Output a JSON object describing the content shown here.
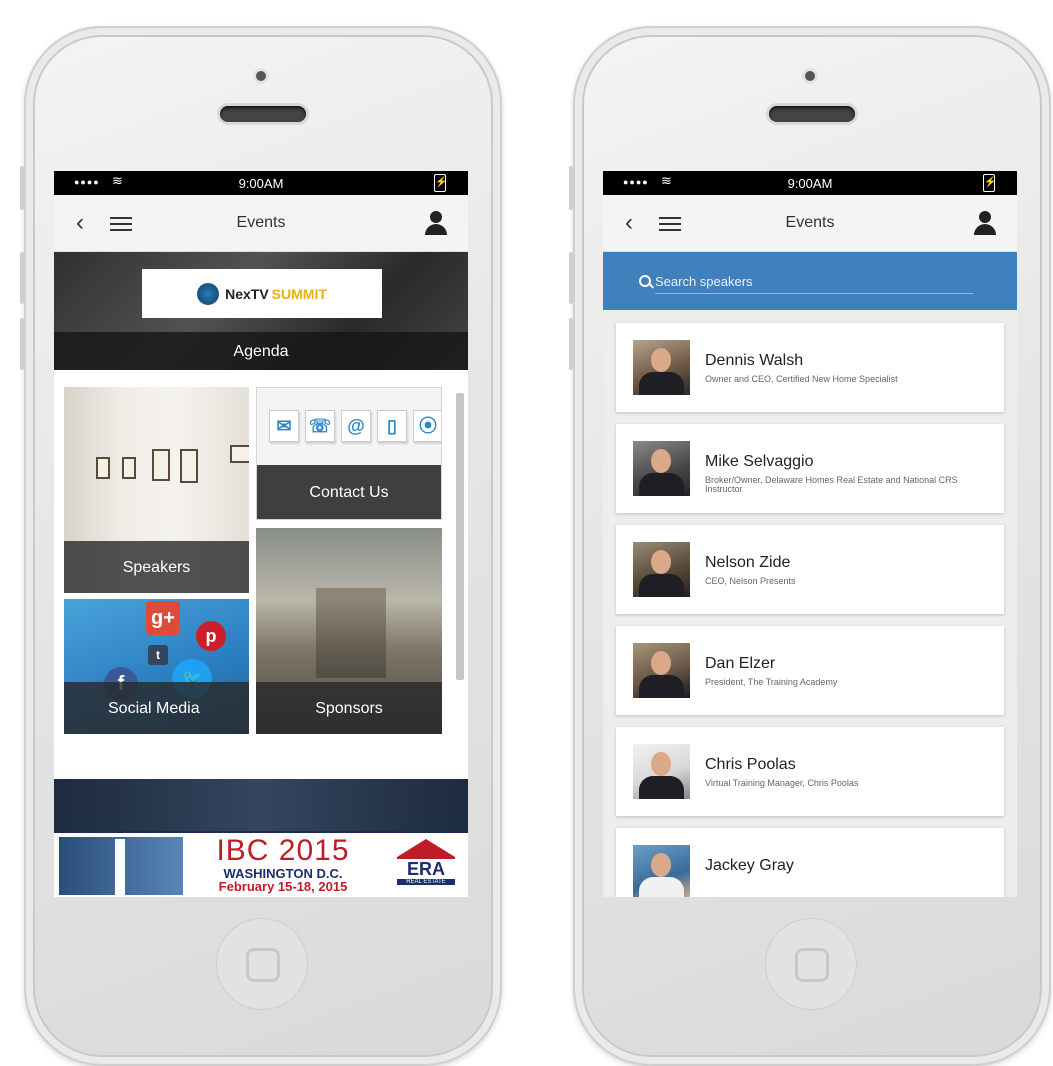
{
  "left_phone": {
    "status": {
      "time": "9:00AM"
    },
    "navbar": {
      "title": "Events"
    },
    "hero": {
      "logo_text": "NexTV",
      "logo_accent": "SUMMIT",
      "agenda_label": "Agenda"
    },
    "tiles": {
      "speakers": "Speakers",
      "contact": "Contact Us",
      "social": "Social Media",
      "sponsors": "Sponsors"
    },
    "banner": {
      "title": "IBC 2015",
      "location": "WASHINGTON D.C.",
      "dates": "February 15-18, 2015",
      "sponsor": "ERA",
      "sponsor_sub": "REAL ESTATE"
    }
  },
  "right_phone": {
    "status": {
      "time": "9:00AM"
    },
    "navbar": {
      "title": "Events"
    },
    "search": {
      "placeholder": "Search speakers"
    },
    "speakers": [
      {
        "name": "Dennis Walsh",
        "title": "Owner and CEO, Certified New Home Specialist"
      },
      {
        "name": "Mike Selvaggio",
        "title": "Broker/Owner, Delaware Homes Real Estate and National CRS Instructor"
      },
      {
        "name": "Nelson Zide",
        "title": "CEO, Nelson Presents"
      },
      {
        "name": "Dan Elzer",
        "title": "President, The Training Academy"
      },
      {
        "name": "Chris Poolas",
        "title": "Virtual Training Manager, Chris Poolas"
      },
      {
        "name": "Jackey Gray",
        "title": ""
      }
    ]
  },
  "colors": {
    "accent_blue": "#3f80bd",
    "tile_overlay": "#3f3f3f",
    "status_bar": "#000000"
  }
}
